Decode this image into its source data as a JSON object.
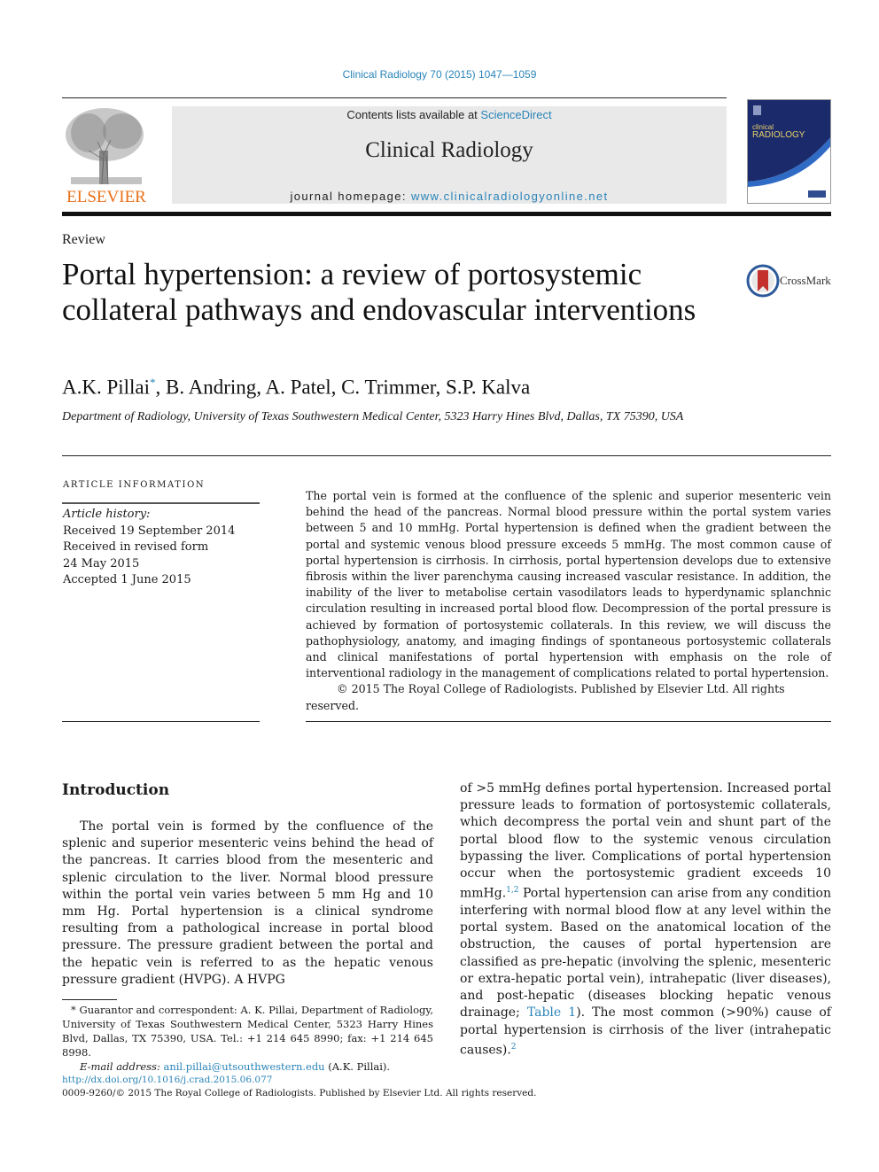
{
  "header": {
    "citation": "Clinical Radiology 70 (2015) 1047—1059",
    "publisher_logo_text": "ELSEVIER",
    "contents_prefix": "Contents lists available at ",
    "contents_link": "ScienceDirect",
    "journal_name": "Clinical Radiology",
    "homepage_prefix": "journal homepage: ",
    "homepage_link": "www.clinicalradiologyonline.net",
    "cover_line1": "clinical",
    "cover_line2": "RADIOLOGY"
  },
  "article": {
    "type": "Review",
    "title": "Portal hypertension: a review of portosystemic collateral pathways and endovascular interventions",
    "crossmark_label": "CrossMark",
    "authors_first": "A.K. Pillai",
    "authors_mark": "*",
    "authors_rest": ", B. Andring, A. Patel, C. Trimmer, S.P. Kalva",
    "affiliation": "Department of Radiology, University of Texas Southwestern Medical Center, 5323 Harry Hines Blvd, Dallas, TX 75390, USA"
  },
  "article_info": {
    "heading": "ARTICLE INFORMATION",
    "history_label": "Article history:",
    "lines": [
      "Received 19 September 2014",
      "Received in revised form",
      "24 May 2015",
      "Accepted 1 June 2015"
    ]
  },
  "abstract": {
    "text": "The portal vein is formed at the confluence of the splenic and superior mesenteric vein behind the head of the pancreas. Normal blood pressure within the portal system varies between 5 and 10 mmHg. Portal hypertension is defined when the gradient between the portal and systemic venous blood pressure exceeds 5 mmHg. The most common cause of portal hypertension is cirrhosis. In cirrhosis, portal hypertension develops due to extensive fibrosis within the liver parenchyma causing increased vascular resistance. In addition, the inability of the liver to metabolise certain vasodilators leads to hyperdynamic splanchnic circulation resulting in increased portal blood flow. Decompression of the portal pressure is achieved by formation of portosystemic collaterals. In this review, we will discuss the pathophysiology, anatomy, and imaging findings of spontaneous portosystemic collaterals and clinical manifestations of portal hypertension with emphasis on the role of interventional radiology in the management of complications related to portal hypertension.",
    "copyright": "© 2015 The Royal College of Radiologists. Published by Elsevier Ltd. All rights reserved."
  },
  "body": {
    "intro_heading": "Introduction",
    "col1_text": "The portal vein is formed by the confluence of the splenic and superior mesenteric veins behind the head of the pancreas. It carries blood from the mesenteric and splenic circulation to the liver. Normal blood pressure within the portal vein varies between 5 mm Hg and 10 mm Hg. Portal hypertension is a clinical syndrome resulting from a pathological increase in portal blood pressure. The pressure gradient between the portal and the hepatic vein is referred to as the hepatic venous pressure gradient (HVPG). A HVPG",
    "col2_part1": "of >5 mmHg defines portal hypertension. Increased portal pressure leads to formation of portosystemic collaterals, which decompress the portal vein and shunt part of the portal blood flow to the systemic venous circulation bypassing the liver. Complications of portal hypertension occur when the portosystemic gradient exceeds 10 mmHg.",
    "col2_ref1": "1,2",
    "col2_part2": " Portal hypertension can arise from any condition interfering with normal blood flow at any level within the portal system. Based on the anatomical location of the obstruction, the causes of portal hypertension are classified as pre-hepatic (involving the splenic, mesenteric or extra-hepatic portal vein), intrahepatic (liver diseases), and post-hepatic (diseases blocking hepatic venous drainage; ",
    "col2_table_link": "Table 1",
    "col2_part3": "). The most common (>90%) cause of portal hypertension is cirrhosis of the liver (intrahepatic causes).",
    "col2_ref2": "2"
  },
  "footnote": {
    "line1": "* Guarantor and correspondent: A. K. Pillai, Department of Radiology, University of Texas Southwestern Medical Center, 5323 Harry Hines Blvd, Dallas, TX 75390, USA. Tel.: +1 214 645 8990; fax: +1 214 645 8998.",
    "email_label": "E-mail address: ",
    "email": "anil.pillai@utsouthwestern.edu",
    "email_suffix": " (A.K. Pillai)."
  },
  "footer": {
    "doi": "http://dx.doi.org/10.1016/j.crad.2015.06.077",
    "issn_copyright": "0009-9260/© 2015 The Royal College of Radiologists. Published by Elsevier Ltd. All rights reserved."
  }
}
